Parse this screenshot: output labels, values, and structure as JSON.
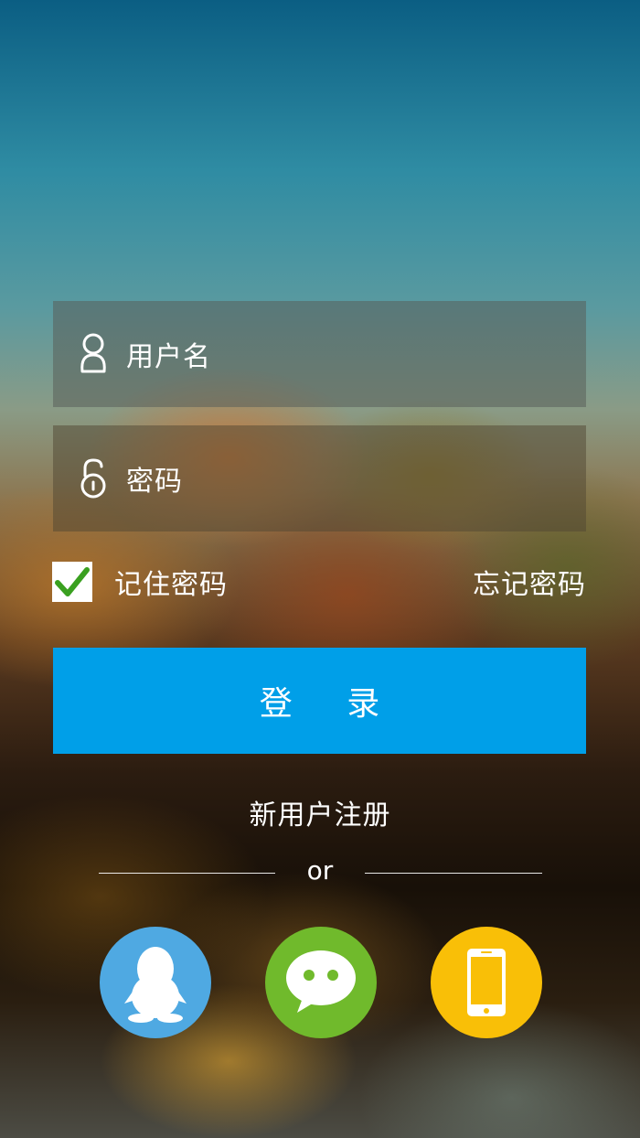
{
  "form": {
    "username_placeholder": "用户名",
    "password_placeholder": "密码",
    "user_icon": "user-icon",
    "lock_icon": "lock-icon"
  },
  "options": {
    "remember_label": "记住密码",
    "remember_checked": true,
    "forgot_label": "忘记密码"
  },
  "login": {
    "label": "登 录",
    "color": "#009fe8"
  },
  "register": {
    "label": "新用户注册"
  },
  "divider": {
    "label": "or"
  },
  "social": [
    {
      "name": "qq",
      "icon": "qq-penguin-icon",
      "color": "#4fa9e2"
    },
    {
      "name": "wechat",
      "icon": "wechat-icon",
      "color": "#70ba2c"
    },
    {
      "name": "phone",
      "icon": "phone-icon",
      "color": "#f9bf07"
    }
  ]
}
